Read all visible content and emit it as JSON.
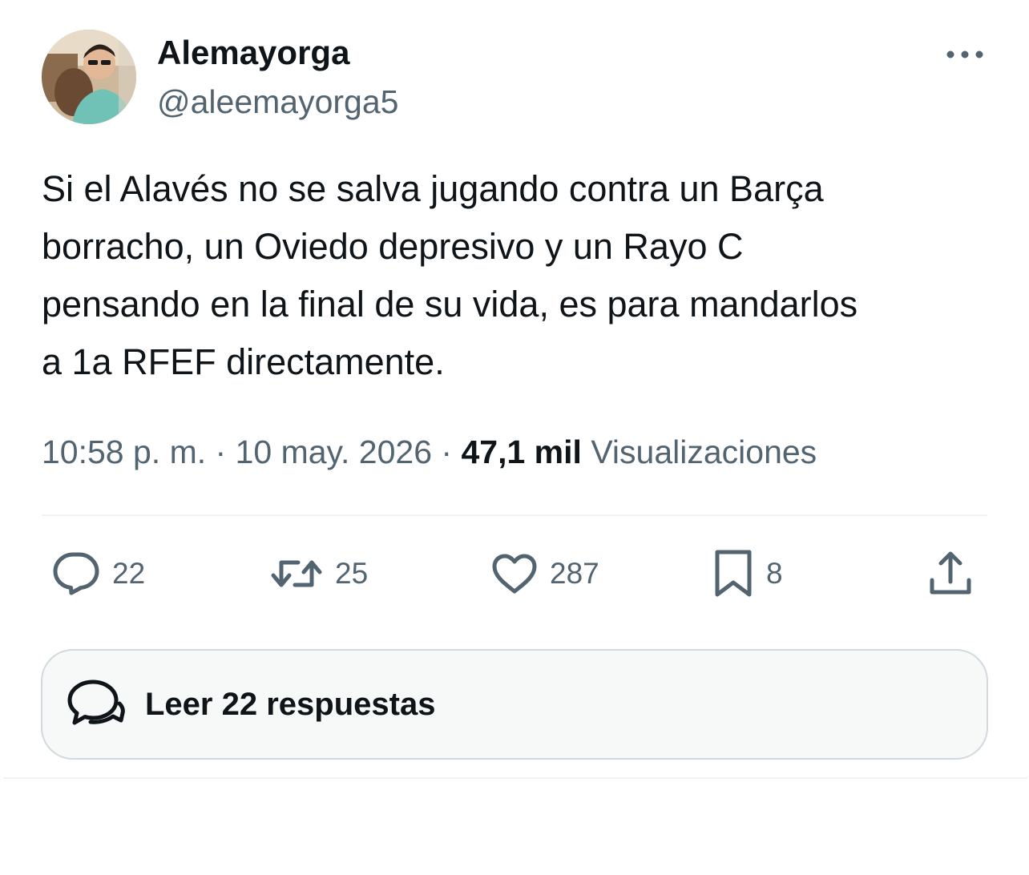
{
  "author": {
    "display_name": "Alemayorga",
    "handle": "@aleemayorga5"
  },
  "tweet": {
    "text": "Si el Alavés no se salva jugando contra un Barça\nborracho, un Oviedo depresivo y un Rayo C\npensando en la final de su vida, es para mandarlos\na 1a RFEF directamente."
  },
  "meta": {
    "time": "10:58 p. m.",
    "separator": "·",
    "date": "10 may. 2026",
    "views_count": "47,1 mil",
    "views_label": "Visualizaciones"
  },
  "actions": {
    "replies": "22",
    "reposts": "25",
    "likes": "287",
    "bookmarks": "8"
  },
  "read_replies": {
    "label": "Leer 22 respuestas"
  },
  "colors": {
    "text": "#0f1419",
    "secondary": "#536471",
    "border": "#cfd9de",
    "divider": "#eff3f4",
    "button_bg": "#f7f9f9"
  },
  "icons": {
    "more": "more-horizontal-icon",
    "reply": "reply-bubble-icon",
    "repost": "repost-icon",
    "like": "heart-icon",
    "bookmark": "bookmark-icon",
    "share": "share-icon",
    "replies_button": "conversation-icon"
  }
}
